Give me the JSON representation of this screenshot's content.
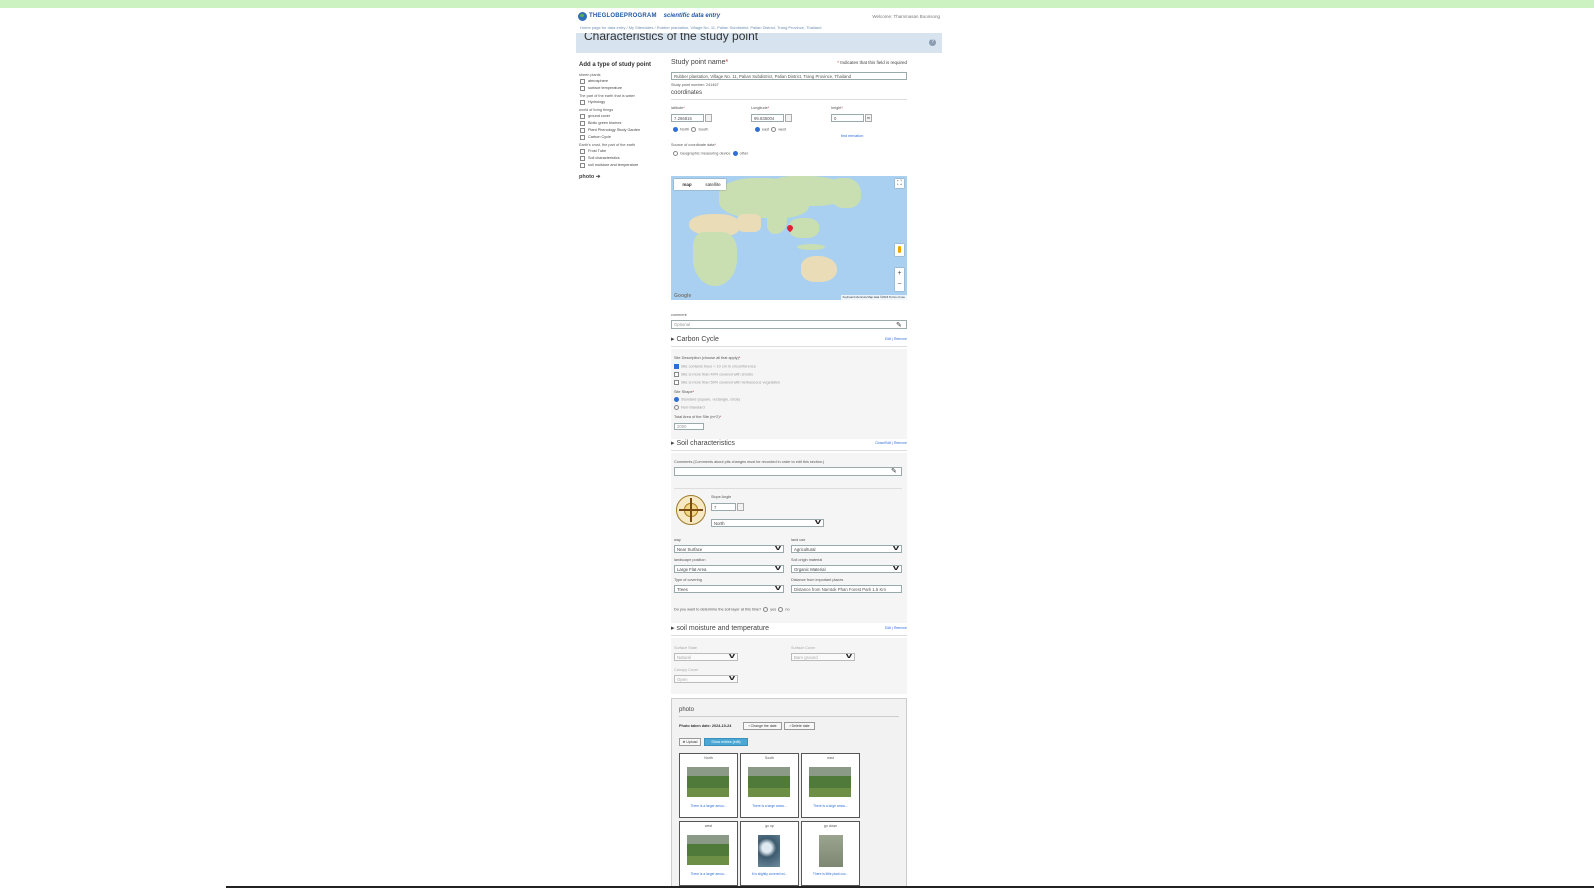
{
  "header": {
    "logo_text": "THEGLOBEPROGRAM",
    "app_name": "scientific data entry",
    "welcome": "Welcome: Thammasan Boonsong",
    "breadcrumb": "Home page for data entry /  My Sites/sites  /  Rubber plantation, Village No. 11, Pailan Subdistrict, Palian District, Trang Province, Thailand"
  },
  "title": "Characteristics of the study point",
  "sidebar": {
    "heading": "Add a type of study point",
    "groups": [
      {
        "label": "sheen plants",
        "items": [
          "atmosphere",
          "surface temperature"
        ]
      },
      {
        "label": "The part of the earth that is water",
        "items": [
          "Hydrology"
        ]
      },
      {
        "label": "world of living things",
        "items": [
          "ground cover",
          "Biotic green biomes",
          "Plant Phenology Study Garden",
          "Carbon Cycle"
        ]
      },
      {
        "label": "Earth's crust, the part of the earth",
        "items": [
          "Frost Tube",
          "Soil characteristics",
          "soil moisture and temperature"
        ]
      }
    ],
    "photo_link": "photo ➔"
  },
  "form": {
    "study_point_label": "Study point name",
    "required_note": "Indicates that this field is required",
    "study_point_value": "Rubber plantation, Village No. 11, Palian Subdistrict, Palian District, Trang Province, Thailand",
    "study_point_number": "Study point number: 241467",
    "coordinates_heading": "coordinates",
    "latitude_label": "latitude",
    "latitude_value": "7.266816",
    "lat_north": "North",
    "lat_south": "South",
    "longitude_label": "Longitude",
    "longitude_value": "99.835004",
    "lon_east": "east",
    "lon_west": "west",
    "height_label": "height",
    "height_value": "0",
    "height_unit": "m",
    "get_elevation": "find elevation",
    "source_label": "Source of coordinate data",
    "source_opt1": "Geographic measuring device",
    "source_opt2": "other",
    "comment_label": "comment",
    "comment_placeholder": "Optional"
  },
  "map": {
    "tab_map": "map",
    "tab_satellite": "satellite",
    "google": "Google",
    "attribution": "Keyboard shortcuts  Map data ©2024  Terms of use"
  },
  "carbon": {
    "heading": "Carbon Cycle",
    "actions": "Edit | Remove",
    "site_desc_label": "Site Description (choose all that apply)",
    "opts": [
      "Site contains trees > 10 cm in circumference",
      "Site is more than 40% covered with shrubs",
      "Site is more than 50% covered with herbaceous vegetation"
    ],
    "shape_label": "Site Shape",
    "shape_opts": [
      "Standard (square, rectangle, circle)",
      "Non-Standard"
    ],
    "area_label": "Total Area of the Site (m^2)",
    "area_value": "2000"
  },
  "soil": {
    "heading": "Soil characteristics",
    "actions": "Close/Edit | Remove",
    "comments_label": "Comments (Comments about pits changes must be recorded in order to edit this section.)",
    "slope_label": "Slope Angle",
    "slope_value": "7",
    "direction_value": "North",
    "field_labels": [
      "way",
      "land use",
      "landscape position",
      "Soil origin material",
      "Type of covering",
      "Distance from important places"
    ],
    "field_values": [
      "Near Surface",
      "Agricultural",
      "Large Flat Area",
      "Organic Material",
      "Trees",
      "Distance from Namtok Phan Forest Park 1.5 Km"
    ],
    "question": "Do you want to determine the soil layer at this time?",
    "yes": "yes",
    "no": "no"
  },
  "moisture": {
    "heading": "soil moisture and temperature",
    "actions": "Edit | Remove",
    "surface_state_label": "Surface State",
    "surface_state_value": "Natural",
    "surface_cover_label": "Surface Cover",
    "surface_cover_value": "Bare ground",
    "canopy_cover_label": "Canopy Cover",
    "canopy_cover_value": "Open"
  },
  "photo": {
    "heading": "photo",
    "date_label": "Photo taken date: 2024-10-24",
    "change_date": "Change the date",
    "delete_date": "Delete date",
    "upload": "Upload",
    "show_btn": "Show entries (edit)",
    "cards": [
      {
        "title": "North",
        "caption": "There is a larger amou..."
      },
      {
        "title": "South",
        "caption": "There is a large amou..."
      },
      {
        "title": "east",
        "caption": "There is a large amou..."
      },
      {
        "title": "west",
        "caption": "There is a larger amou..."
      },
      {
        "title": "go up",
        "caption": "It is slightly covered wi..."
      },
      {
        "title": "go down",
        "caption": "There is little plant cov..."
      }
    ]
  },
  "colors": {
    "accent": "#2e6fd6",
    "title_bar": "#d7e3ef",
    "top_band": "#cdf2c2"
  }
}
